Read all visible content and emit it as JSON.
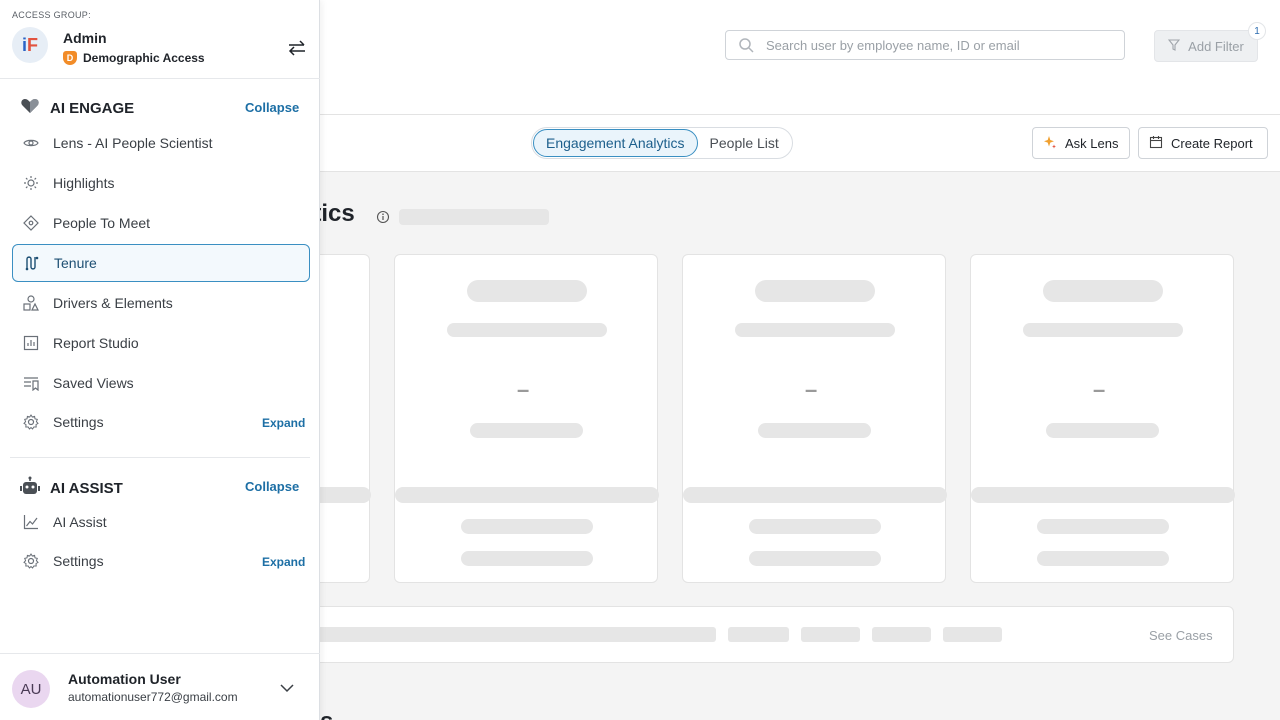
{
  "header": {
    "search_placeholder": "Search user by employee name, ID or email",
    "add_filter_label": "Add Filter",
    "filter_count": "1"
  },
  "subheader": {
    "tabs": [
      {
        "label": "Engagement Analytics",
        "active": true
      },
      {
        "label": "People List",
        "active": false
      }
    ],
    "ask_lens_label": "Ask Lens",
    "create_report_label": "Create Report"
  },
  "main": {
    "page_title_fragment": "ytics",
    "card_value_placeholder": "–",
    "see_cases_label": "See Cases",
    "bottom_title_fragment": "sis"
  },
  "sidebar": {
    "access_group_label": "ACCESS GROUP:",
    "logo_text_i": "i",
    "logo_text_f": "F",
    "role": "Admin",
    "access_badge": "D",
    "access_name": "Demographic Access",
    "sections": [
      {
        "title": "AI ENGAGE",
        "toggle_label": "Collapse",
        "items": [
          {
            "label": "Lens - AI People Scientist",
            "icon": "eye-icon"
          },
          {
            "label": "Highlights",
            "icon": "sun-icon"
          },
          {
            "label": "People To Meet",
            "icon": "diamond-icon"
          },
          {
            "label": "Tenure",
            "icon": "tenure-path-icon",
            "active": true
          },
          {
            "label": "Drivers & Elements",
            "icon": "shapes-icon"
          },
          {
            "label": "Report Studio",
            "icon": "report-icon"
          },
          {
            "label": "Saved Views",
            "icon": "saved-views-icon"
          },
          {
            "label": "Settings",
            "icon": "gear-icon",
            "expand_label": "Expand"
          }
        ]
      },
      {
        "title": "AI ASSIST",
        "toggle_label": "Collapse",
        "items": [
          {
            "label": "AI Assist",
            "icon": "chart-line-icon"
          },
          {
            "label": "Settings",
            "icon": "gear-icon",
            "expand_label": "Expand"
          }
        ]
      }
    ],
    "user": {
      "initials": "AU",
      "name": "Automation User",
      "email": "automationuser772@gmail.com"
    }
  },
  "colors": {
    "accent": "#1d6fa5",
    "active_border": "#3a8fc2",
    "skeleton": "#e6e6e6"
  }
}
